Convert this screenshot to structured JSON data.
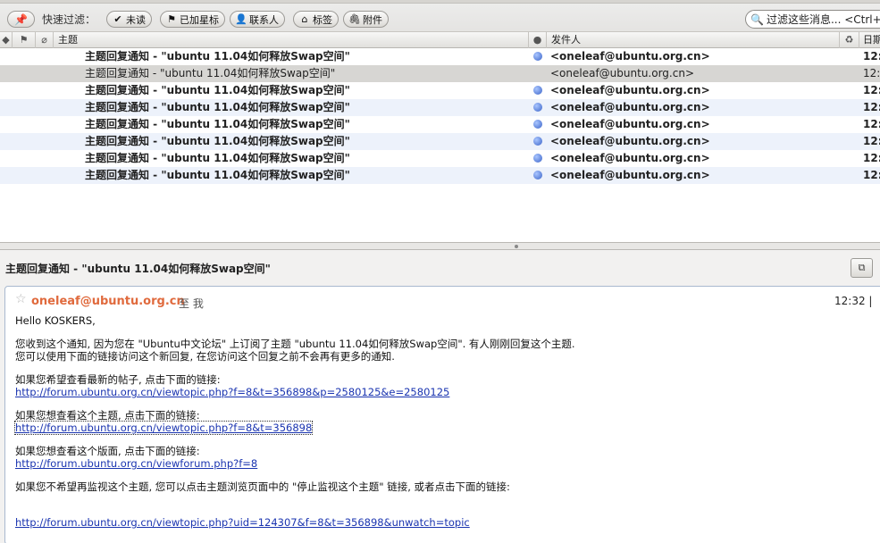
{
  "filter": {
    "label": "快速过滤：",
    "buttons": [
      {
        "label": "未读",
        "icon": "check-icon"
      },
      {
        "label": "已加星标",
        "icon": "flag-icon"
      },
      {
        "label": "联系人",
        "icon": "person-icon"
      },
      {
        "label": "标签",
        "icon": "tag-icon"
      },
      {
        "label": "附件",
        "icon": "paperclip-icon"
      }
    ],
    "search_placeholder": "过滤这些消息... <Ctrl+"
  },
  "columns": {
    "subject": "主题",
    "sender": "发件人",
    "date": "日期"
  },
  "messages": [
    {
      "subject": "主题回复通知 - \"ubuntu 11.04如何释放Swap空间\"",
      "from": "<oneleaf@ubuntu.org.cn>",
      "date": "12:",
      "unread": true
    },
    {
      "subject": "主题回复通知 - \"ubuntu 11.04如何释放Swap空间\"",
      "from": "<oneleaf@ubuntu.org.cn>",
      "date": "12:",
      "unread": false
    },
    {
      "subject": "主题回复通知 - \"ubuntu 11.04如何释放Swap空间\"",
      "from": "<oneleaf@ubuntu.org.cn>",
      "date": "12:",
      "unread": true
    },
    {
      "subject": "主题回复通知 - \"ubuntu 11.04如何释放Swap空间\"",
      "from": "<oneleaf@ubuntu.org.cn>",
      "date": "12:",
      "unread": true
    },
    {
      "subject": "主题回复通知 - \"ubuntu 11.04如何释放Swap空间\"",
      "from": "<oneleaf@ubuntu.org.cn>",
      "date": "12:",
      "unread": true
    },
    {
      "subject": "主题回复通知 - \"ubuntu 11.04如何释放Swap空间\"",
      "from": "<oneleaf@ubuntu.org.cn>",
      "date": "12:",
      "unread": true
    },
    {
      "subject": "主题回复通知 - \"ubuntu 11.04如何释放Swap空间\"",
      "from": "<oneleaf@ubuntu.org.cn>",
      "date": "12:",
      "unread": true
    },
    {
      "subject": "主题回复通知 - \"ubuntu 11.04如何释放Swap空间\"",
      "from": "<oneleaf@ubuntu.org.cn>",
      "date": "12:",
      "unread": true
    }
  ],
  "message": {
    "title": "主题回复通知 - \"ubuntu 11.04如何释放Swap空间\"",
    "sender": "oneleaf@ubuntu.org.cn",
    "to": "至 我",
    "time": "12:32 |",
    "greeting": "Hello KOSKERS,",
    "intro1": "您收到这个通知, 因为您在 \"Ubuntu中文论坛\" 上订阅了主题 \"ubuntu 11.04如何释放Swap空间\". 有人刚刚回复这个主题.",
    "intro2": "您可以使用下面的链接访问这个新回复, 在您访问这个回复之前不会再有更多的通知.",
    "latest_label": "如果您希望查看最新的帖子, 点击下面的链接:",
    "latest_link": "http://forum.ubuntu.org.cn/viewtopic.php?f=8&t=356898&p=2580125&e=2580125",
    "topic_label": "如果您想查看这个主题, 点击下面的链接:",
    "topic_link": "http://forum.ubuntu.org.cn/viewtopic.php?f=8&t=356898",
    "forum_label": "如果您想查看这个版面, 点击下面的链接:",
    "forum_link": "http://forum.ubuntu.org.cn/viewforum.php?f=8",
    "unwatch_label": "如果您不希望再监视这个主题, 您可以点击主题浏览页面中的 \"停止监视这个主题\" 链接, 或者点击下面的链接:",
    "unwatch_link": "http://forum.ubuntu.org.cn/viewtopic.php?uid=124307&f=8&t=356898&unwatch=topic"
  },
  "colors": {
    "sender": "#e06a3d",
    "link": "#1a34b0",
    "unread_dot": "#3a63c8"
  }
}
